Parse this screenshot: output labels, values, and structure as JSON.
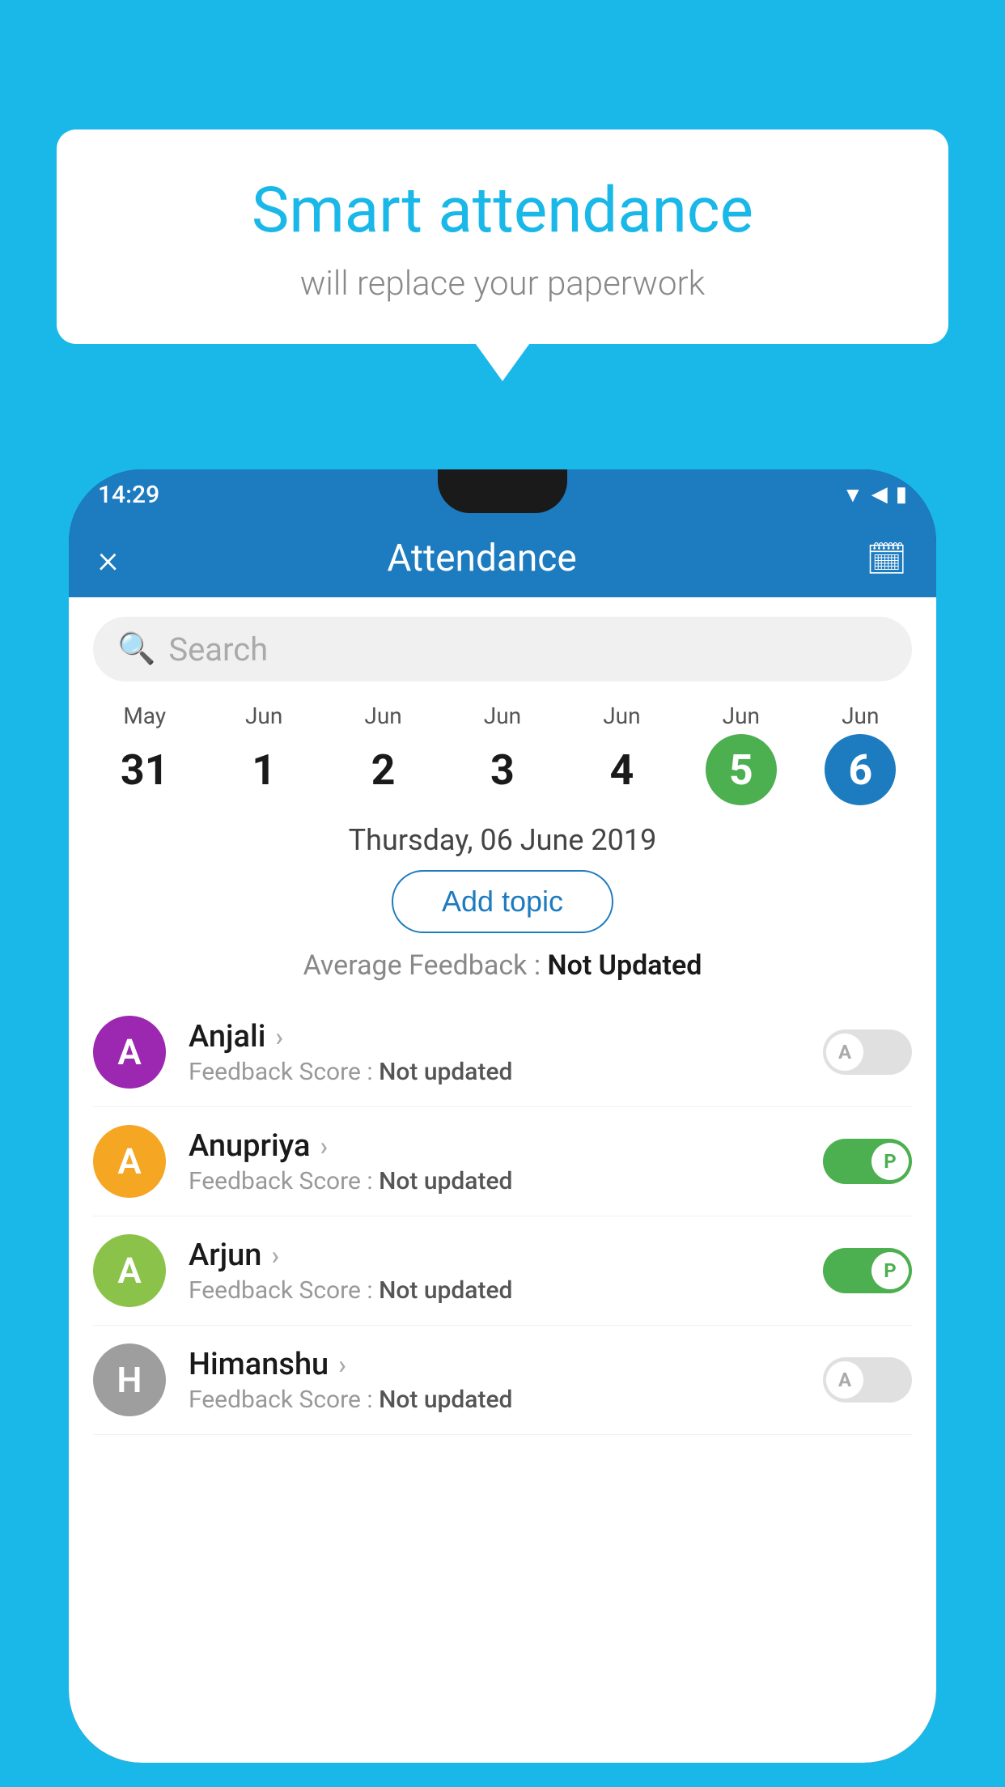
{
  "background_color": "#1ab8e8",
  "speech_bubble": {
    "title": "Smart attendance",
    "subtitle": "will replace your paperwork"
  },
  "status_bar": {
    "time": "14:29",
    "icons": [
      "wifi",
      "signal",
      "battery"
    ]
  },
  "app_bar": {
    "title": "Attendance",
    "close_label": "×",
    "calendar_icon": "📅"
  },
  "search": {
    "placeholder": "Search"
  },
  "calendar": {
    "days": [
      {
        "month": "May",
        "date": "31",
        "style": "normal"
      },
      {
        "month": "Jun",
        "date": "1",
        "style": "normal"
      },
      {
        "month": "Jun",
        "date": "2",
        "style": "normal"
      },
      {
        "month": "Jun",
        "date": "3",
        "style": "normal"
      },
      {
        "month": "Jun",
        "date": "4",
        "style": "normal"
      },
      {
        "month": "Jun",
        "date": "5",
        "style": "today"
      },
      {
        "month": "Jun",
        "date": "6",
        "style": "selected"
      }
    ]
  },
  "selected_date": "Thursday, 06 June 2019",
  "add_topic_label": "Add topic",
  "avg_feedback_label": "Average Feedback :",
  "avg_feedback_value": "Not Updated",
  "students": [
    {
      "name": "Anjali",
      "avatar_letter": "A",
      "avatar_color": "#9c27b0",
      "feedback_label": "Feedback Score :",
      "feedback_value": "Not updated",
      "attendance": "absent",
      "toggle_letter": "A"
    },
    {
      "name": "Anupriya",
      "avatar_letter": "A",
      "avatar_color": "#f5a623",
      "feedback_label": "Feedback Score :",
      "feedback_value": "Not updated",
      "attendance": "present",
      "toggle_letter": "P"
    },
    {
      "name": "Arjun",
      "avatar_letter": "A",
      "avatar_color": "#8bc34a",
      "feedback_label": "Feedback Score :",
      "feedback_value": "Not updated",
      "attendance": "present",
      "toggle_letter": "P"
    },
    {
      "name": "Himanshu",
      "avatar_letter": "H",
      "avatar_color": "#9e9e9e",
      "feedback_label": "Feedback Score :",
      "feedback_value": "Not updated",
      "attendance": "absent",
      "toggle_letter": "A"
    }
  ]
}
